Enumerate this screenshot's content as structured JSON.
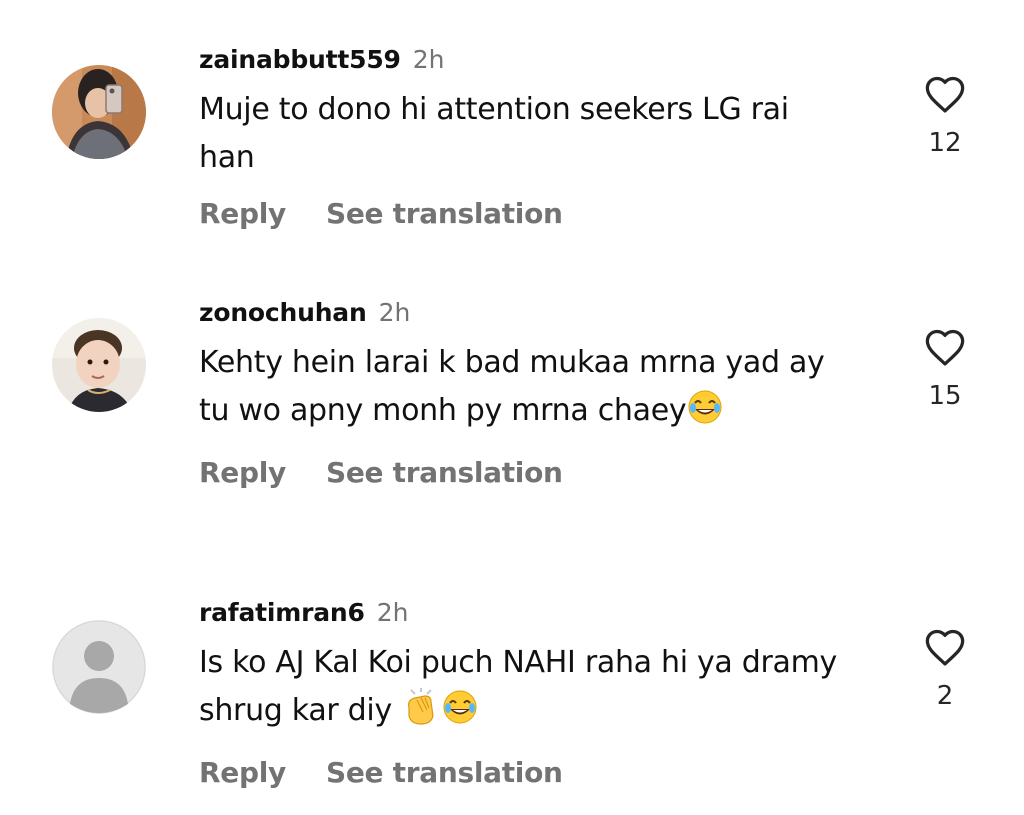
{
  "comments": [
    {
      "username": "zainabbutt559",
      "time": "2h",
      "text": "Muje to dono hi attention seekers LG rai han",
      "likes": "12",
      "reply_label": "Reply",
      "translate_label": "See translation"
    },
    {
      "username": "zonochuhan",
      "time": "2h",
      "text": "Kehty hein larai k bad mukaa mrna yad ay tu wo apny monh py mrna chaey",
      "emojis": [
        "face-with-tears-of-joy"
      ],
      "likes": "15",
      "reply_label": "Reply",
      "translate_label": "See translation"
    },
    {
      "username": "rafatimran6",
      "time": "2h",
      "text": "Is ko AJ Kal Koi puch NAHI raha hi ya dramy shrug kar diy ",
      "emojis": [
        "clapping-hands",
        "face-with-tears-of-joy"
      ],
      "likes": "2",
      "reply_label": "Reply",
      "translate_label": "See translation"
    }
  ],
  "colors": {
    "primary_text": "#111111",
    "secondary_text": "#737373",
    "background": "#ffffff",
    "default_avatar_bg": "#e6e6e6",
    "default_avatar_fg": "#a8a8a8"
  }
}
